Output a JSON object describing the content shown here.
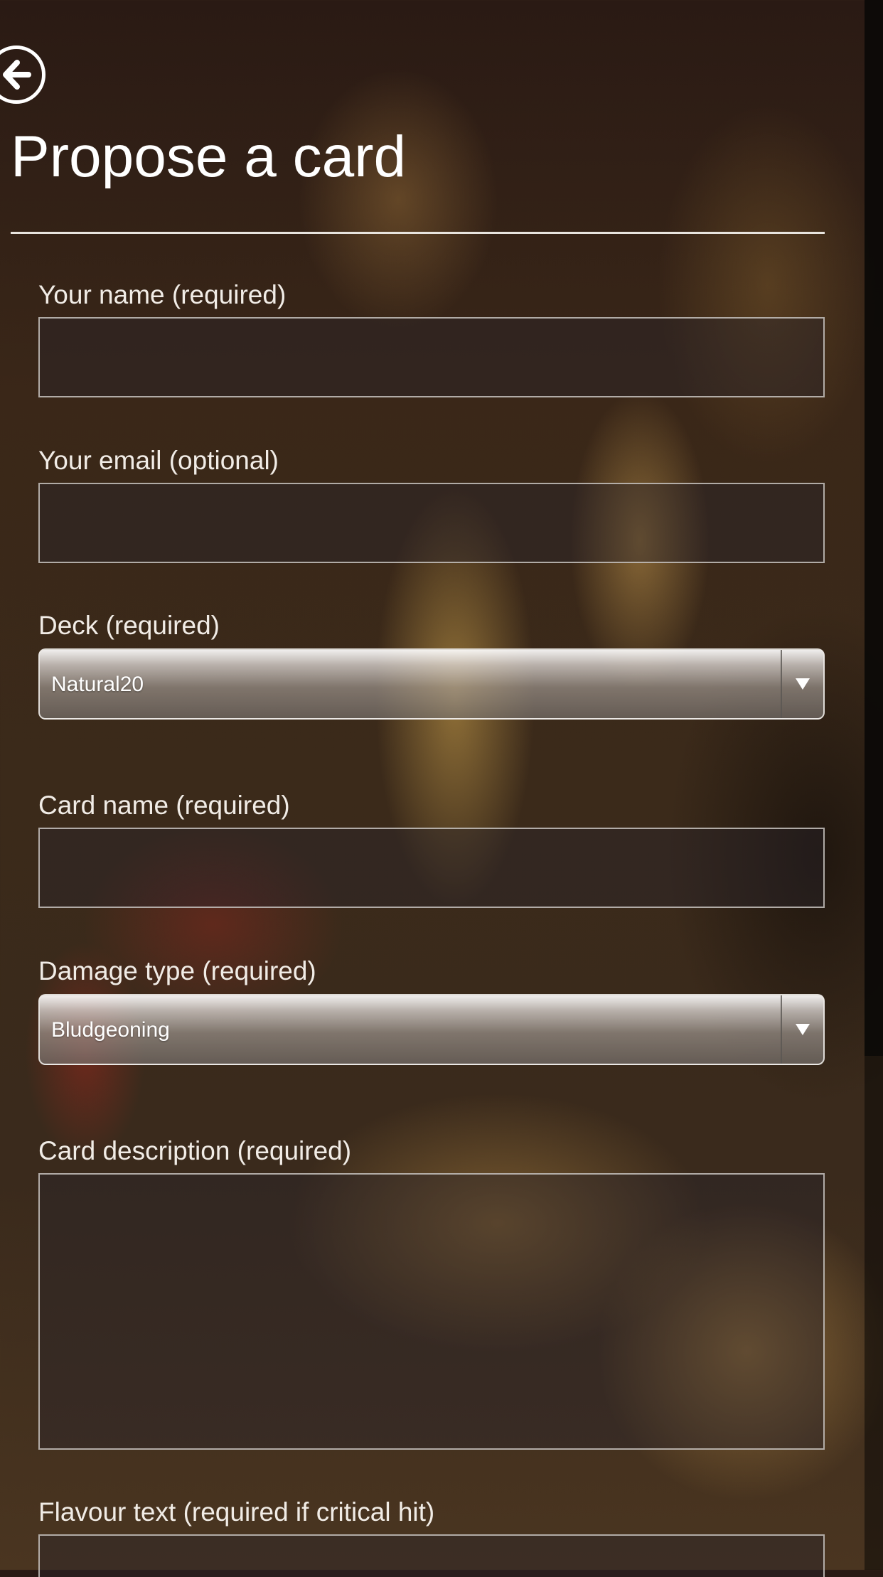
{
  "header": {
    "title": "Propose a card"
  },
  "form": {
    "your_name": {
      "label": "Your name (required)",
      "value": ""
    },
    "your_email": {
      "label": "Your email (optional)",
      "value": ""
    },
    "deck": {
      "label": "Deck (required)",
      "selected": "Natural20"
    },
    "card_name": {
      "label": "Card name (required)",
      "value": ""
    },
    "damage_type": {
      "label": "Damage type (required)",
      "selected": "Bludgeoning"
    },
    "card_description": {
      "label": "Card description (required)",
      "value": ""
    },
    "flavour_text": {
      "label": "Flavour text (required if critical hit)",
      "value": ""
    }
  },
  "icons": {
    "back": "arrow-left-circle-icon",
    "dropdown": "triangle-down-icon"
  },
  "colors": {
    "text": "#ffffff",
    "field_border": "#c8c3be",
    "background_dark": "#2a1a14"
  }
}
